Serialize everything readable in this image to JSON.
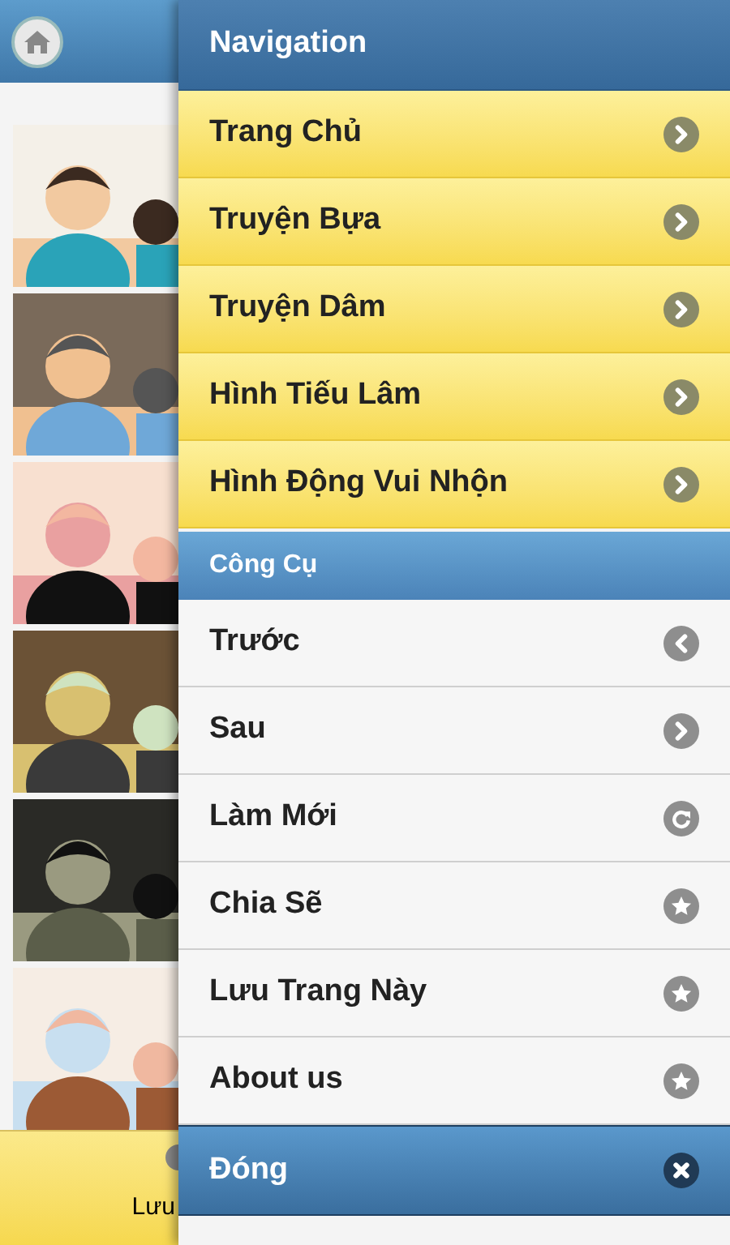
{
  "main": {
    "bottom_bar": {
      "label": "Lưu"
    }
  },
  "navigation": {
    "title": "Navigation",
    "items": [
      {
        "label": "Trang Chủ",
        "kind": "forward"
      },
      {
        "label": "Truyện Bựa",
        "kind": "forward"
      },
      {
        "label": "Truyện Dâm",
        "kind": "forward"
      },
      {
        "label": "Hình Tiếu Lâm",
        "kind": "forward"
      },
      {
        "label": "Hình Động Vui Nhộn",
        "kind": "forward"
      }
    ],
    "tools_header": "Công Cụ",
    "tools": [
      {
        "label": "Trước",
        "kind": "back"
      },
      {
        "label": "Sau",
        "kind": "forward"
      },
      {
        "label": "Làm Mới",
        "kind": "reload"
      },
      {
        "label": "Chia Sẽ",
        "kind": "favorite"
      },
      {
        "label": "Lưu Trang Này",
        "kind": "favorite"
      },
      {
        "label": "About us",
        "kind": "favorite"
      }
    ],
    "close": {
      "label": "Đóng",
      "kind": "dismiss"
    }
  }
}
